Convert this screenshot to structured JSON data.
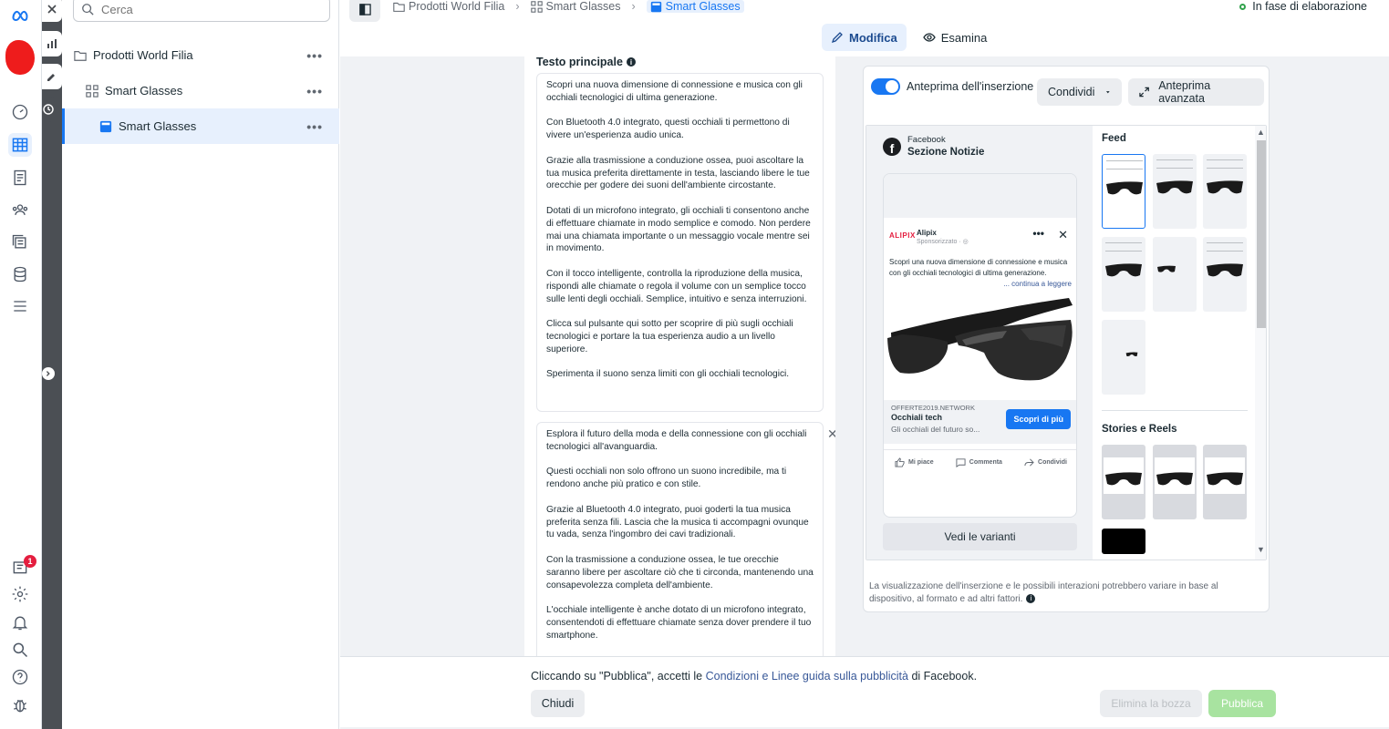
{
  "search": {
    "placeholder": "Cerca"
  },
  "tree": {
    "items": [
      {
        "label": "Prodotti World Filia",
        "icon": "folder-icon"
      },
      {
        "label": "Smart Glasses",
        "icon": "grid-icon"
      },
      {
        "label": "Smart Glasses",
        "icon": "ad-square-icon"
      }
    ],
    "more": "•••"
  },
  "breadcrumb": [
    "Prodotti World Filia",
    "Smart Glasses",
    "Smart Glasses"
  ],
  "status": "In fase di elaborazione",
  "tabs": {
    "edit": "Modifica",
    "review": "Esamina"
  },
  "editor": {
    "section_title": "Testo principale",
    "text1": [
      "Scopri una nuova dimensione di connessione e musica con gli occhiali tecnologici di ultima generazione.",
      "Con Bluetooth 4.0 integrato, questi occhiali ti permettono di vivere un'esperienza audio unica.",
      "Grazie alla trasmissione a conduzione ossea, puoi ascoltare la tua musica preferita direttamente in testa, lasciando libere le tue orecchie per godere dei suoni dell'ambiente circostante.",
      "Dotati di un microfono integrato, gli occhiali ti consentono anche di effettuare chiamate in modo semplice e comodo. Non perdere mai una chiamata importante o un messaggio vocale mentre sei in movimento.",
      "Con il tocco intelligente, controlla la riproduzione della musica, rispondi alle chiamate o regola il volume con un semplice tocco sulle lenti degli occhiali. Semplice, intuitivo e senza interruzioni.",
      "Clicca sul pulsante qui sotto per scoprire di più sugli occhiali tecnologici e portare la tua esperienza audio a un livello superiore.",
      "Sperimenta il suono senza limiti con gli occhiali tecnologici."
    ],
    "text2": [
      "Esplora il futuro della moda e della connessione con gli occhiali tecnologici all'avanguardia.",
      "Questi occhiali non solo offrono un suono incredibile, ma ti rendono anche più pratico e con stile.",
      "Grazie al Bluetooth 4.0 integrato, puoi goderti la tua musica preferita senza fili. Lascia che la musica ti accompagni ovunque tu vada, senza l'ingombro dei cavi tradizionali.",
      "Con la trasmissione a conduzione ossea, le tue orecchie saranno libere per ascoltare ciò che ti circonda, mantenendo una consapevolezza completa dell'ambiente.",
      "L'occhiale intelligente è anche dotato di un microfono integrato, consentendoti di effettuare chiamate senza dover prendere il tuo smartphone."
    ]
  },
  "preview": {
    "toggle_label": "Anteprima dell'inserzione",
    "share": "Condividi",
    "advanced": "Anteprima avanzata",
    "platform": "Facebook",
    "placement": "Sezione Notizie",
    "ad": {
      "logo": "ALIPIX",
      "page": "Alipix",
      "sponsored": "Sponsorizzato · ",
      "copy": "Scopri una nuova dimensione di connessione e musica con gli occhiali tecnologici di ultima generazione.",
      "more": "... continua a leggere",
      "domain": "OFFERTE2019.NETWORK",
      "headline": "Occhiali tech",
      "description": "Gli occhiali del futuro so...",
      "cta": "Scopri di più",
      "like": "Mi piace",
      "comment": "Commenta",
      "share": "Condividi"
    },
    "variants": "Vedi le varianti",
    "feed_title": "Feed",
    "stories_title": "Stories e Reels",
    "note": "La visualizzazione dell'inserzione e le possibili interazioni potrebbero variare in base al dispositivo, al formato e ad altri fattori."
  },
  "footer": {
    "terms_pre": "Cliccando su \"Pubblica\", accetti le ",
    "terms_link": "Condizioni e Linee guida sulla pubblicità",
    "terms_post": " di Facebook.",
    "close": "Chiudi",
    "delete_draft": "Elimina la bozza",
    "publish": "Pubblica"
  },
  "notifications_count": "1",
  "colors": {
    "accent": "#1877f2",
    "publish_disabled": "#a8e3a0",
    "status_green": "#31a24c"
  }
}
